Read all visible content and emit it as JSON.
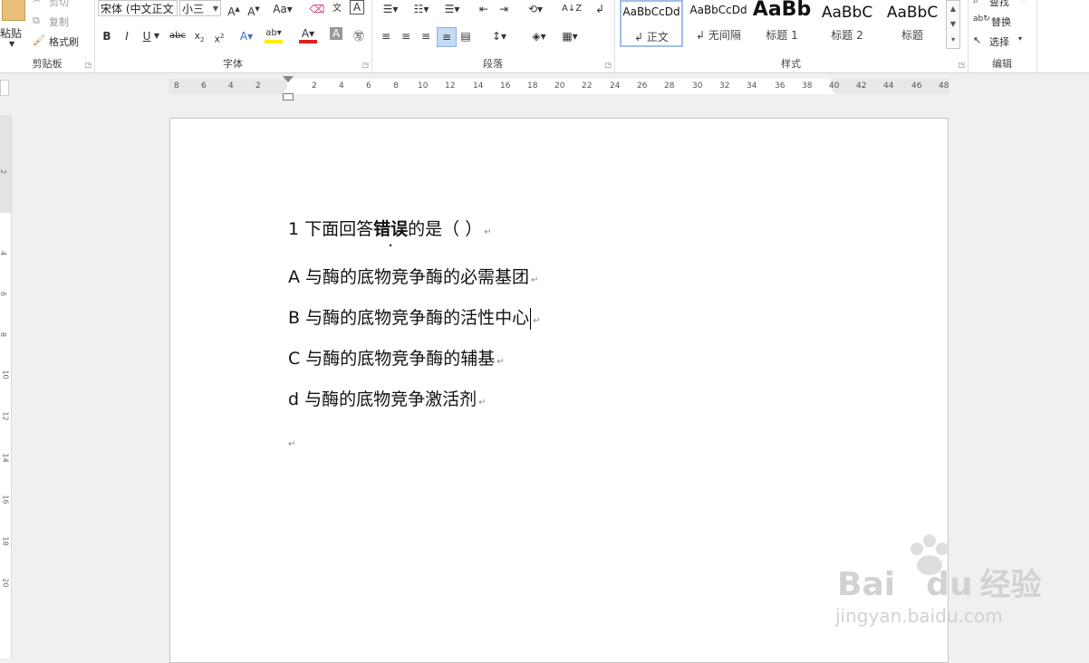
{
  "clipboard": {
    "paste": "粘贴",
    "cut": "剪切",
    "copy": "复制",
    "format_painter": "格式刷",
    "group": "剪贴板"
  },
  "font": {
    "name": "宋体 (中文正文",
    "size": "小三",
    "group": "字体"
  },
  "paragraph": {
    "group": "段落"
  },
  "styles": {
    "group": "样式",
    "items": [
      {
        "preview": "AaBbCcDd",
        "name": "正文"
      },
      {
        "preview": "AaBbCcDd",
        "name": "无间隔"
      },
      {
        "preview": "AaBb",
        "name": "标题 1"
      },
      {
        "preview": "AaBbC",
        "name": "标题 2"
      },
      {
        "preview": "AaBbC",
        "name": "标题"
      }
    ]
  },
  "editing": {
    "find": "查找",
    "replace": "替换",
    "select": "选择",
    "group": "编辑"
  },
  "ruler": {
    "left_ticks": [
      "8",
      "6",
      "4",
      "2"
    ],
    "right_ticks": [
      "2",
      "4",
      "6",
      "8",
      "10",
      "12",
      "14",
      "16",
      "18",
      "20",
      "22",
      "24",
      "26",
      "28",
      "30",
      "32",
      "34",
      "36",
      "38",
      "40",
      "42",
      "44",
      "46",
      "48"
    ]
  },
  "vruler": {
    "ticks": [
      "2",
      "4",
      "6",
      "8",
      "10",
      "12",
      "14",
      "16",
      "18",
      "20"
    ]
  },
  "document": {
    "question_num": "1",
    "question_pre": " 下面回答",
    "question_em": "错误",
    "question_post": "的是（    ）",
    "option_a": "A 与酶的底物竞争酶的必需基团",
    "option_b": "B 与酶的底物竞争酶的活性中心",
    "option_c": "C 与酶的底物竞争酶的辅基",
    "option_d": "d 与酶的底物竞争激活剂",
    "para_mark": "↵"
  },
  "watermark": {
    "brand": "Bai",
    "brand2": "du",
    "cn": "经验",
    "url": "jingyan.baidu.com"
  }
}
